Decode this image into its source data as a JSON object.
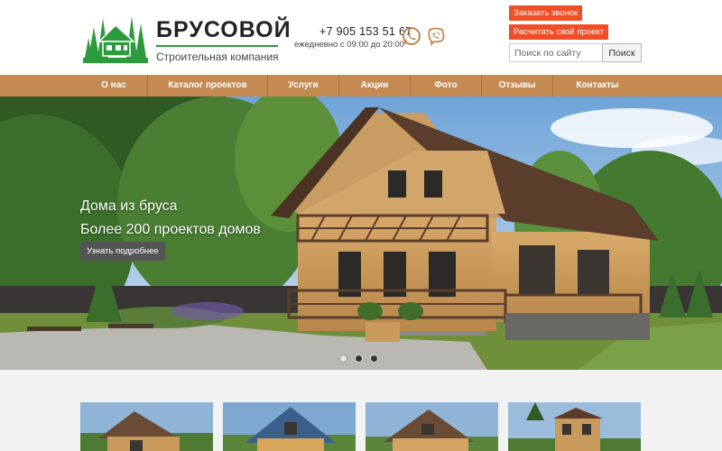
{
  "brand": {
    "name": "БРУСОВОЙ",
    "subtitle": "Строительная компания",
    "accent": "#2e9a3e"
  },
  "contacts": {
    "phone": "+7 905 153 51 67",
    "hours": "ежедневно с 09:00 до 20:00",
    "icons": [
      "whatsapp-icon",
      "viber-icon"
    ],
    "icon_color": "#c48a52"
  },
  "actions": {
    "call": "Заказать звонок",
    "calc": "Расчитать свой проект",
    "color": "#f04e27"
  },
  "search": {
    "placeholder": "Поиск по сайту",
    "value": "",
    "button": "Поиск"
  },
  "nav": {
    "color": "#c48a52",
    "items": [
      {
        "label": "О нас"
      },
      {
        "label": "Каталог проектов"
      },
      {
        "label": "Услуги"
      },
      {
        "label": "Акции"
      },
      {
        "label": "Фото"
      },
      {
        "label": "Отзывы"
      },
      {
        "label": "Контакты"
      }
    ]
  },
  "hero": {
    "title": "Дома из бруса",
    "subtitle": "Более 200 проектов домов",
    "button": "Узнать подробнее",
    "slides": 3,
    "active_slide": 1
  }
}
